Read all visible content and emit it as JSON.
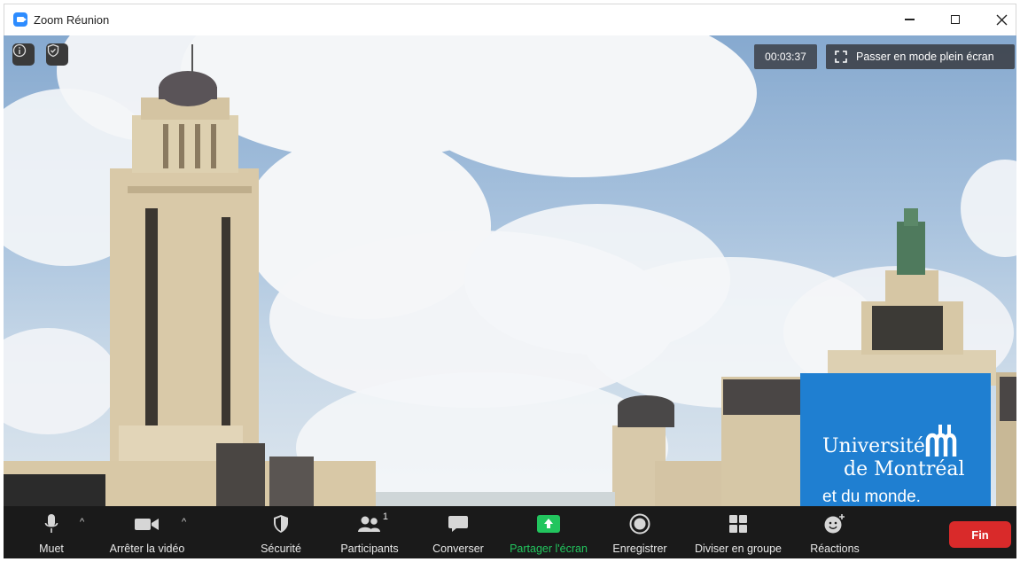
{
  "window": {
    "title": "Zoom Réunion"
  },
  "meeting": {
    "timer": "00:03:37",
    "fullscreen_label": "Passer en mode plein écran"
  },
  "background": {
    "logo_line1": "Université",
    "logo_line2": "de Montréal",
    "logo_line3": "et du monde.",
    "logo_color": "#1f7fd1"
  },
  "toolbar": {
    "mute": "Muet",
    "stop_video": "Arrêter la vidéo",
    "security": "Sécurité",
    "participants": "Participants",
    "participants_count": "1",
    "chat": "Converser",
    "share": "Partager l'écran",
    "record": "Enregistrer",
    "breakout": "Diviser en groupe",
    "reactions": "Réactions",
    "end": "Fin",
    "share_color": "#22c55e",
    "end_color": "#d92a2a"
  }
}
